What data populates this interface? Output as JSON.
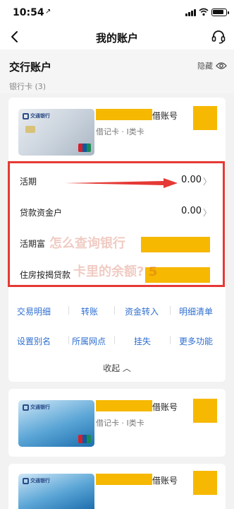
{
  "status": {
    "time": "10:54",
    "location_arrow": "↗"
  },
  "nav": {
    "back": "back-icon",
    "title": "我的账户",
    "support": "headset-icon"
  },
  "section": {
    "title": "交行账户",
    "hide_label": "隐藏",
    "subtitle": "银行卡 (3)"
  },
  "cards": [
    {
      "acct_suffix": "借账号",
      "acct_type": "借记卡 · I类卡",
      "bank_logo": "交通银行"
    },
    {
      "acct_suffix": "借账号",
      "acct_type": "借记卡 · I类卡",
      "bank_logo": "交通银行"
    },
    {
      "acct_suffix": "借账号",
      "bank_logo": "交通银行"
    }
  ],
  "balances": [
    {
      "label": "活期",
      "value": "0.00"
    },
    {
      "label": "贷款资金户",
      "value": "0.00"
    },
    {
      "label": "活期富",
      "value": ""
    },
    {
      "label": "住房按揭贷款",
      "value": ""
    }
  ],
  "actions": {
    "row1": [
      "交易明细",
      "转账",
      "资金转入",
      "明细清单"
    ],
    "row2": [
      "设置别名",
      "所属网点",
      "挂失",
      "更多功能"
    ],
    "collapse": "收起"
  },
  "watermark": {
    "line1": "怎么查询银行",
    "line2": "卡里的余额? 5"
  },
  "colors": {
    "accent": "#2f6fd1",
    "highlight": "#e53935",
    "redaction": "#f6b800"
  }
}
